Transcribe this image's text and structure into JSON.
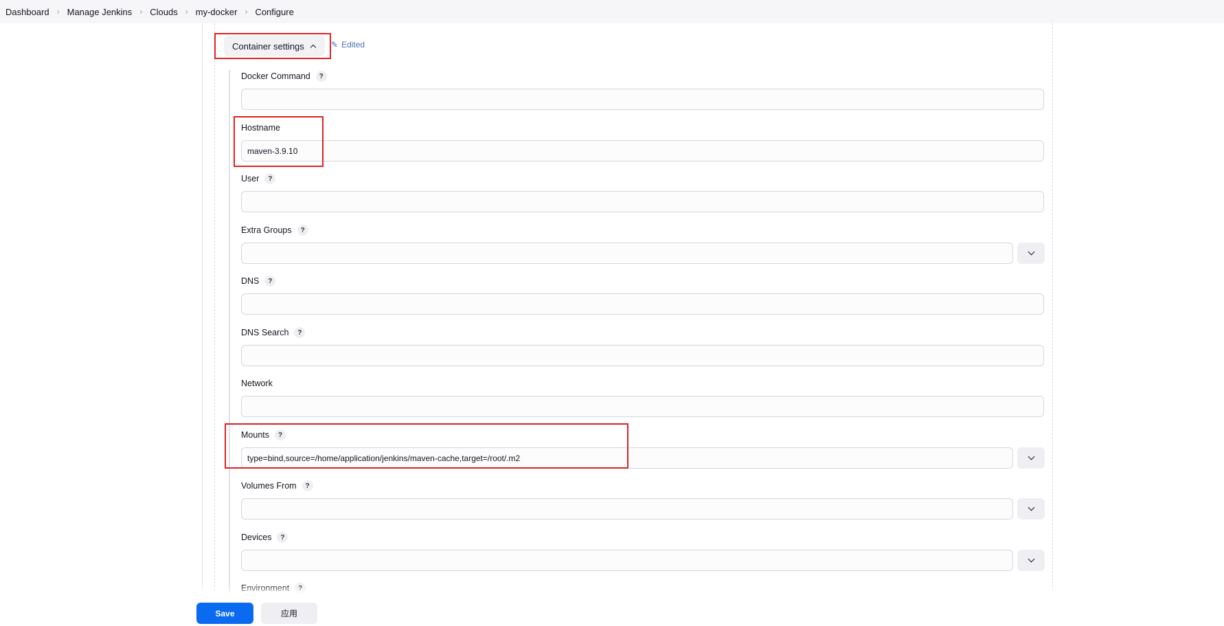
{
  "breadcrumb": [
    "Dashboard",
    "Manage Jenkins",
    "Clouds",
    "my-docker",
    "Configure"
  ],
  "section": {
    "title": "Container settings",
    "edited_label": "Edited"
  },
  "fields": {
    "docker_command": {
      "label": "Docker Command",
      "value": ""
    },
    "hostname": {
      "label": "Hostname",
      "value": "maven-3.9.10"
    },
    "user": {
      "label": "User",
      "value": ""
    },
    "extra_groups": {
      "label": "Extra Groups",
      "value": ""
    },
    "dns": {
      "label": "DNS",
      "value": ""
    },
    "dns_search": {
      "label": "DNS Search",
      "value": ""
    },
    "network": {
      "label": "Network",
      "value": ""
    },
    "mounts": {
      "label": "Mounts",
      "value": "type=bind,source=/home/application/jenkins/maven-cache,target=/root/.m2"
    },
    "volumes_from": {
      "label": "Volumes From",
      "value": ""
    },
    "devices": {
      "label": "Devices",
      "value": ""
    },
    "environment": {
      "label": "Environment"
    }
  },
  "help_glyph": "?",
  "buttons": {
    "save": "Save",
    "apply": "应用"
  },
  "colors": {
    "primary": "#0b6bf0",
    "highlight": "#e02020",
    "edited": "#4b6fb5"
  }
}
